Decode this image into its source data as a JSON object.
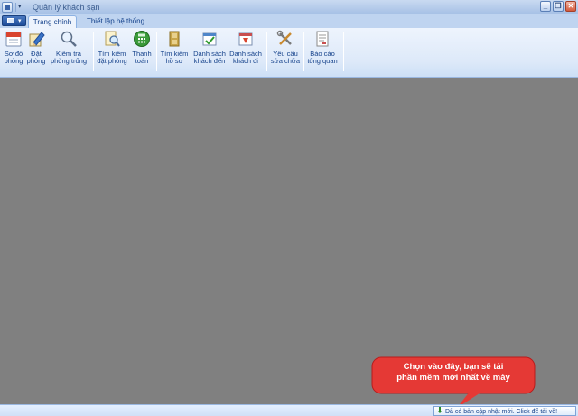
{
  "window": {
    "title": "Quản lý khách sạn"
  },
  "tabs": [
    {
      "label": "Trang chính",
      "active": true
    },
    {
      "label": "Thiết lập hệ thống",
      "active": false
    }
  ],
  "ribbon": {
    "items": [
      {
        "line1": "Sơ đồ",
        "line2": "phòng",
        "icon": "calendar-icon"
      },
      {
        "line1": "Đặt",
        "line2": "phòng",
        "icon": "edit-pencil-icon"
      },
      {
        "line1": "Kiểm tra",
        "line2": "phòng trống",
        "icon": "magnifier-icon"
      },
      {
        "line1": "Tìm kiếm",
        "line2": "đặt phòng",
        "icon": "search-document-icon"
      },
      {
        "line1": "Thanh",
        "line2": "toán",
        "icon": "calculator-icon"
      },
      {
        "line1": "Tìm kiếm",
        "line2": "hồ sơ",
        "icon": "file-cabinet-icon"
      },
      {
        "line1": "Danh sách",
        "line2": "khách đến",
        "icon": "guest-arrival-icon"
      },
      {
        "line1": "Danh sách",
        "line2": "khách đi",
        "icon": "guest-departure-icon"
      },
      {
        "line1": "Yêu cầu",
        "line2": "sửa chữa",
        "icon": "tools-icon"
      },
      {
        "line1": "Báo cáo",
        "line2": "tổng quan",
        "icon": "report-icon"
      }
    ]
  },
  "callout": {
    "line1": "Chọn vào đây, bạn sẽ tải",
    "line2": "phần mềm mới nhất về máy",
    "color": "#e53935"
  },
  "status": {
    "update_text": "Đã có bản cập nhật mới. Click để tải về!"
  }
}
